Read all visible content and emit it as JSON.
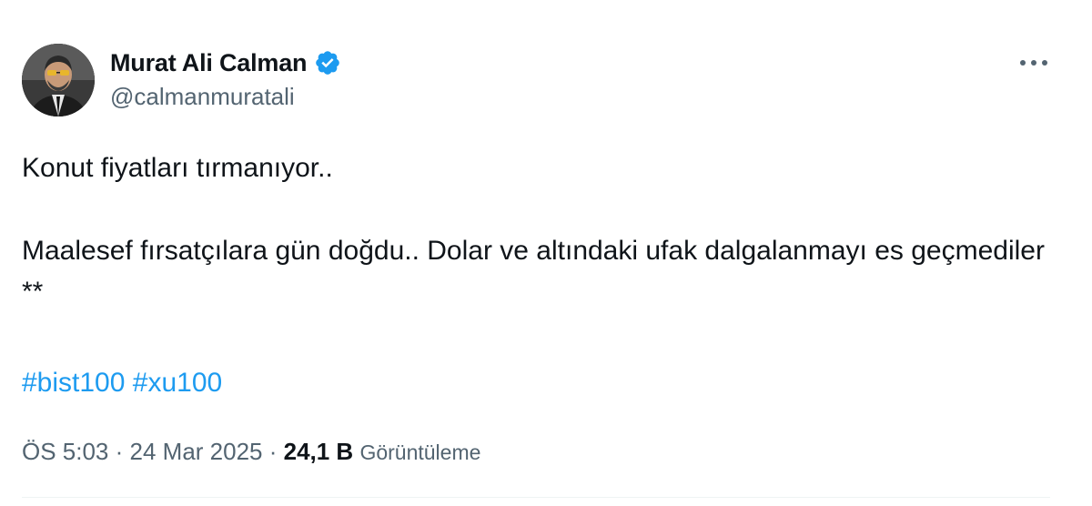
{
  "author": {
    "display_name": "Murat Ali Calman",
    "handle": "@calmanmuratali",
    "verified": true
  },
  "icons": {
    "verified": "verified-badge-icon",
    "more": "more-horizontal-icon"
  },
  "colors": {
    "accent": "#1d9bf0",
    "text_primary": "#0f1419",
    "text_secondary": "#536471"
  },
  "tweet": {
    "line1": "Konut fiyatları tırmanıyor..",
    "line2": "Maalesef fırsatçılara gün doğdu.. Dolar ve altındaki ufak dalgalanmayı es geçmediler",
    "line3": "**",
    "hashtags": [
      "#bist100",
      "#xu100"
    ]
  },
  "meta": {
    "time": "ÖS 5:03",
    "separator": " · ",
    "date": "24 Mar 2025",
    "views_count": "24,1 B",
    "views_label": "Görüntüleme"
  }
}
